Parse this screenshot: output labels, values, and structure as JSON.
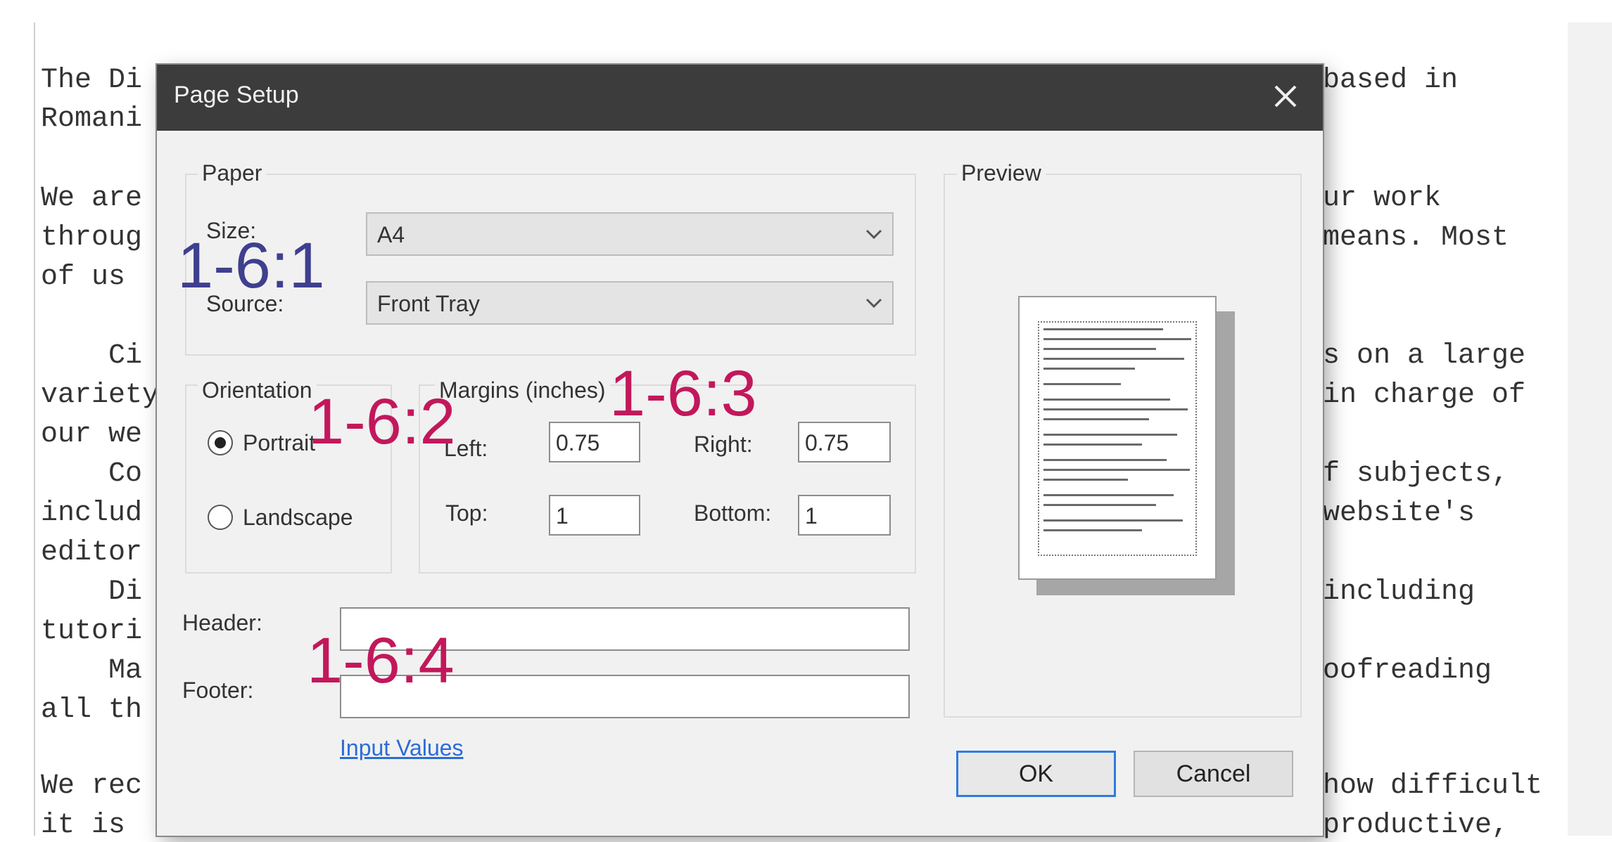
{
  "background_text": {
    "lines_left": [
      "The Di",
      "Romani",
      "We are",
      "throug",
      "of us ",
      "    Ci",
      "variety",
      "our we",
      "    Co",
      "includ",
      "editor",
      "    Di",
      "tutori",
      "    Ma",
      "all th",
      "We rec",
      "it is "
    ],
    "lines_right": [
      "based in",
      "ur work",
      "means. Most",
      "s on a large",
      "in charge of",
      "f subjects,",
      "website's",
      "including",
      "oofreading",
      "how difficult",
      "productive,"
    ]
  },
  "dialog": {
    "title": "Page Setup",
    "close_icon": "close-icon",
    "paper": {
      "group_label": "Paper",
      "size_label": "Size:",
      "size_value": "A4",
      "source_label": "Source:",
      "source_value": "Front Tray"
    },
    "orientation": {
      "group_label": "Orientation",
      "portrait_label": "Portrait",
      "landscape_label": "Landscape",
      "selected": "Portrait"
    },
    "margins": {
      "group_label": "Margins (inches)",
      "left_label": "Left:",
      "left_value": "0.75",
      "right_label": "Right:",
      "right_value": "0.75",
      "top_label": "Top:",
      "top_value": "1",
      "bottom_label": "Bottom:",
      "bottom_value": "1"
    },
    "header_label": "Header:",
    "header_value": "",
    "footer_label": "Footer:",
    "footer_value": "",
    "input_values_link": "Input Values",
    "preview_label": "Preview",
    "ok_label": "OK",
    "cancel_label": "Cancel"
  },
  "annotations": {
    "a1": "1-6:1",
    "a2": "1-6:2",
    "a3": "1-6:3",
    "a4": "1-6:4"
  },
  "colors": {
    "titlebar": "#3c3c3c",
    "dialog_bg": "#f1f1f1",
    "annotation": "#c2185b",
    "annotation_first": "#3f3f8f",
    "link": "#2b6cd6",
    "ok_border": "#2f7be0"
  }
}
